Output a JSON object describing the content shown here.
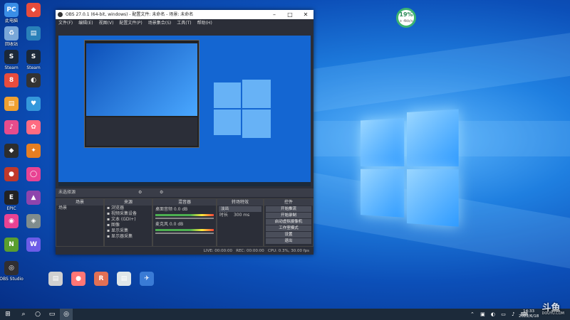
{
  "desktop": {
    "icons_col1": [
      {
        "label": "此电脑",
        "color": "#3a8ee6",
        "glyph": "PC"
      },
      {
        "label": "回收站",
        "color": "#7aa7d8",
        "glyph": "♻"
      },
      {
        "label": "Steam",
        "color": "#1b2838",
        "glyph": "S"
      },
      {
        "label": "",
        "color": "#e84c3d",
        "glyph": "8"
      },
      {
        "label": "",
        "color": "#f0a030",
        "glyph": "▤"
      },
      {
        "label": "",
        "color": "#e74c8c",
        "glyph": "♪"
      },
      {
        "label": "",
        "color": "#2d2d2d",
        "glyph": "◆"
      },
      {
        "label": "",
        "color": "#c0392b",
        "glyph": "●"
      },
      {
        "label": "EPIC",
        "color": "#222",
        "glyph": "E"
      },
      {
        "label": "",
        "color": "#e84393",
        "glyph": "◉"
      },
      {
        "label": "",
        "color": "#5a9e2f",
        "glyph": "N"
      },
      {
        "label": "OBS Studio",
        "color": "#302e31",
        "glyph": "◎"
      }
    ],
    "icons_col2": [
      {
        "label": "",
        "color": "#e74c3c",
        "glyph": "◆"
      },
      {
        "label": "",
        "color": "#2980b9",
        "glyph": "▤"
      },
      {
        "label": "Steam",
        "color": "#1b2838",
        "glyph": "S"
      },
      {
        "label": "",
        "color": "#333",
        "glyph": "◐"
      },
      {
        "label": "",
        "color": "#3498db",
        "glyph": "♥"
      },
      {
        "label": "",
        "color": "#ff6b81",
        "glyph": "✿"
      },
      {
        "label": "",
        "color": "#e67e22",
        "glyph": "✦"
      },
      {
        "label": "",
        "color": "#e84393",
        "glyph": "◯"
      },
      {
        "label": "",
        "color": "#8e44ad",
        "glyph": "▲"
      },
      {
        "label": "",
        "color": "#7f8c8d",
        "glyph": "◈"
      },
      {
        "label": "",
        "color": "#6c5ce7",
        "glyph": "W"
      }
    ],
    "bottom_icons": [
      {
        "label": "",
        "color": "#d0d0d0",
        "glyph": "▤"
      },
      {
        "label": "",
        "color": "#ff7675",
        "glyph": "●"
      },
      {
        "label": "",
        "color": "#e17055",
        "glyph": "R"
      },
      {
        "label": "",
        "color": "#dfe6e9",
        "glyph": "▤"
      },
      {
        "label": "",
        "color": "#3a7bd5",
        "glyph": "✈"
      }
    ],
    "network_meter": {
      "percent": "19%",
      "speed": "+ 4kb/s"
    }
  },
  "obs": {
    "title": "OBS 27.0.1 (64-bit, windows) - 配置文件: 未命名 - 场景: 未命名",
    "menu": [
      "文件(F)",
      "编辑(E)",
      "视图(V)",
      "配置文件(P)",
      "场景集合(S)",
      "工具(T)",
      "帮助(H)"
    ],
    "scene_label": "未选择源",
    "docks": {
      "scenes": {
        "header": "场景",
        "items": [
          "场景"
        ]
      },
      "sources": {
        "header": "来源",
        "items": [
          "浏览器",
          "视频采集设备",
          "文本 (GDI+)",
          "图像",
          "显示采集",
          "显示器采集"
        ]
      },
      "mixer": {
        "header": "混音器",
        "items": [
          {
            "name": "桌面音频",
            "level": "0.0 dB"
          },
          {
            "name": "麦克风",
            "level": "0.0 dB"
          }
        ]
      },
      "transitions": {
        "header": "转场特效",
        "type": "淡出",
        "duration_label": "时长",
        "duration": "300 ms"
      },
      "controls": {
        "header": "控件",
        "buttons": [
          "开始推流",
          "开始录制",
          "启动虚拟摄像机",
          "工作室模式",
          "设置",
          "退出"
        ]
      }
    },
    "status": {
      "live": "LIVE: 00:00:00",
      "rec": "REC: 00:00:00",
      "cpu": "CPU: 0.3%, 30.00 fps"
    }
  },
  "taskbar": {
    "time": "14:33",
    "date": "2022/6/18"
  },
  "watermark": {
    "main": "斗鱼",
    "sub": "DOUYU.COM"
  }
}
